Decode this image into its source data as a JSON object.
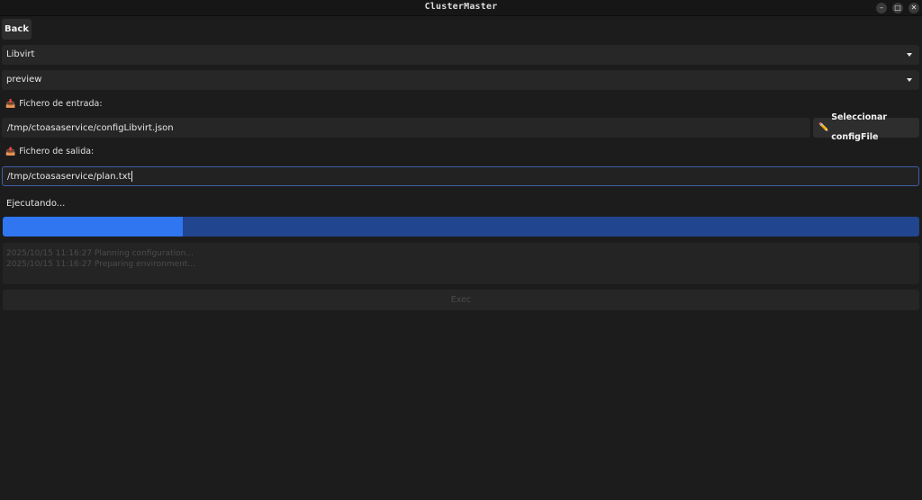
{
  "window": {
    "title": "ClusterMaster",
    "minimize_glyph": "–",
    "maximize_glyph": "□",
    "close_glyph": "✕"
  },
  "nav": {
    "back_label": "Back"
  },
  "provider_select": {
    "value": "Libvirt"
  },
  "mode_select": {
    "value": "preview"
  },
  "input_file": {
    "label": "Fichero de entrada:",
    "icon": "inbox-tray-icon",
    "value": "/tmp/ctoasaservice/configLibvirt.json"
  },
  "select_config_button": {
    "label": "Seleccionar configFile",
    "icon": "pencil-icon"
  },
  "output_file": {
    "label": "Fichero de salida:",
    "icon": "outbox-tray-icon",
    "value": "/tmp/ctoasaservice/plan.txt"
  },
  "status_text": "Ejecutando...",
  "progress": {
    "fraction": 0.196
  },
  "log_lines": [
    "2025/10/15 11:16:27 Planning configuration...",
    "2025/10/15 11:16:27 Preparing environment..."
  ],
  "exec_button": {
    "label": "Exec",
    "enabled": false
  },
  "colors": {
    "background": "#1c1c1c",
    "progress_fill": "#2f76f0",
    "progress_track": "#22458f",
    "focus_border": "#3f5fa8"
  }
}
